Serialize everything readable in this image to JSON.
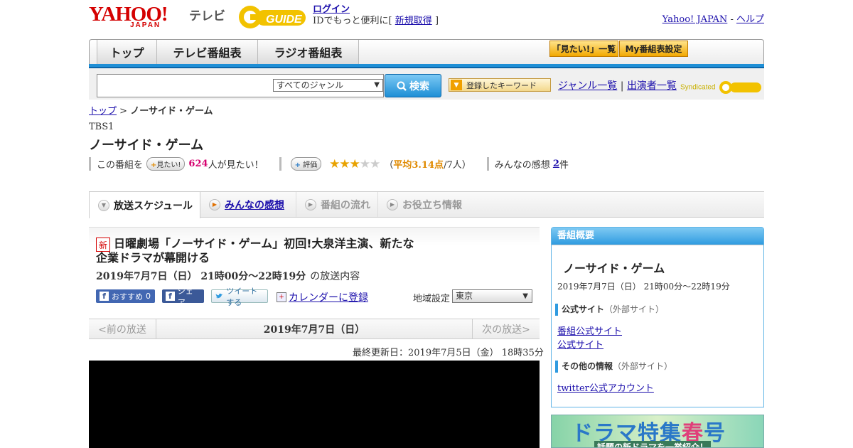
{
  "header": {
    "logo_yahoo": "YAHOO!",
    "logo_japan": "JAPAN",
    "logo_tv": "テレビ",
    "logo_gguide": "G GUIDE",
    "login": "ログイン",
    "login_desc": "IDでもっと便利に[",
    "signup": "新規取得",
    "bracket_close": "]",
    "yahoo_japan_link": "Yahoo! JAPAN",
    "sep": "-",
    "help_link": "ヘルプ"
  },
  "nav": {
    "tabs": [
      "トップ",
      "テレビ番組表",
      "ラジオ番組表"
    ],
    "want_list": "「見たい!」一覧",
    "my_listing": "My番組表設定"
  },
  "search": {
    "input_value": "",
    "genre": "すべてのジャンル",
    "button": "検索",
    "keyword_button": "登録したキーワード",
    "genre_list": "ジャンル一覧",
    "divider": "|",
    "cast_list": "出演者一覧",
    "syndicated": "Syndicated"
  },
  "breadcrumb": {
    "top": "トップ",
    "sep": ">",
    "current": "ノーサイド・ゲーム"
  },
  "program": {
    "channel": "TBS1",
    "title": "ノーサイド・ゲーム",
    "want_prefix": "この番組を",
    "want_btn": "見たい!",
    "want_count": "624",
    "want_suffix": "人が見たい！",
    "rating_btn": "評価",
    "stars_on": "★★★",
    "stars_off": "★★",
    "avg_open": "（",
    "avg_label": "平均3.14点",
    "avg_people": "/7人）",
    "impressions_label": "みんなの感想",
    "impressions_count": "2",
    "impressions_unit": "件"
  },
  "content_tabs": {
    "schedule": "放送スケジュール",
    "impressions": "みんなの感想",
    "flow": "番組の流れ",
    "info": "お役立ち情報"
  },
  "episode": {
    "new_badge": "新",
    "title_line1": "日曜劇場「ノーサイド・ゲーム」初回!大泉洋主演、新たな",
    "title_line2": "企業ドラマが幕開ける",
    "date": "2019年7月7日（日） 21時00分～22時19分",
    "date_suffix": "の放送内容",
    "fb_recommend": "おすすめ",
    "fb_count": "0",
    "fb_share": "シェア",
    "tweet": "ツイートする",
    "calendar": "カレンダーに登録",
    "region_label": "地域設定",
    "region_value": "東京"
  },
  "pager": {
    "prev": "<前の放送",
    "current": "2019年7月7日（日）",
    "next": "次の放送>"
  },
  "updated": "最終更新日：2019年7月5日（金） 18時35分",
  "side": {
    "head": "番組概要",
    "title": "ノーサイド・ゲーム",
    "date": "2019年7月7日（日） 21時00分～22時19分",
    "official_head": "公式サイト",
    "external_note": "（外部サイト）",
    "official_links": [
      "番組公式サイト",
      "公式サイト"
    ],
    "other_head": "その他の情報",
    "other_links": [
      "twitter公式アカウント"
    ]
  },
  "banner": {
    "line1_a": "ドラマ特集",
    "line1_b": "春",
    "line1_c": "号",
    "line2": "話題の新ドラマを一挙紹介！"
  },
  "colors": {
    "accent_blue": "#1e8fd6",
    "brand_red": "#d40000",
    "star": "#e8a200",
    "pink": "#d6006f"
  }
}
